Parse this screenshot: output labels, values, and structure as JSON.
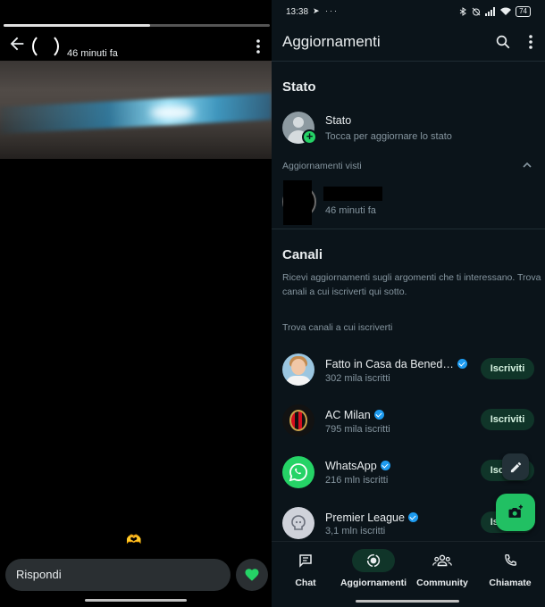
{
  "left": {
    "progress_fraction": 0.55,
    "time_ago": "46 minuti fa",
    "reply_placeholder": "Rispondi",
    "heart_glyph": "🫶",
    "icons": {
      "back": "arrow-left-icon",
      "more": "more-vertical-icon",
      "like": "heart-icon"
    }
  },
  "statusbar": {
    "time": "13:38",
    "left_icons": "➤ ···",
    "battery": "74"
  },
  "header": {
    "title": "Aggiornamenti"
  },
  "status_section": {
    "title": "Stato",
    "my_status": {
      "title": "Stato",
      "subtitle": "Tocca per aggiornare lo stato"
    },
    "viewed_header": "Aggiornamenti visti",
    "viewed_item": {
      "time": "46 minuti fa"
    }
  },
  "channels_section": {
    "title": "Canali",
    "description": "Ricevi aggiornamenti sugli argomenti che ti interessano. Trova canali a cui iscriverti qui sotto.",
    "find_header": "Trova canali a cui iscriverti",
    "subscribe_label": "Iscriviti",
    "channels": [
      {
        "name": "Fatto in Casa da Bened…",
        "followers": "302 mila iscritti",
        "verified": true,
        "avatar": "person-photo"
      },
      {
        "name": "AC Milan",
        "followers": "795 mila iscritti",
        "verified": true,
        "avatar": "ac-milan-crest"
      },
      {
        "name": "WhatsApp",
        "followers": "216 mln iscritti",
        "verified": true,
        "avatar": "whatsapp-logo"
      },
      {
        "name": "Premier League",
        "followers": "3,1 mln iscritti",
        "verified": true,
        "avatar": "premier-league-logo"
      }
    ]
  },
  "nav": {
    "items": [
      {
        "label": "Chat",
        "icon": "chat-icon",
        "active": false
      },
      {
        "label": "Aggiornamenti",
        "icon": "updates-icon",
        "active": true
      },
      {
        "label": "Community",
        "icon": "community-icon",
        "active": false
      },
      {
        "label": "Chiamate",
        "icon": "phone-icon",
        "active": false
      }
    ]
  },
  "colors": {
    "background": "#0b141a",
    "accent_green": "#25d366",
    "fab_green": "#21c063",
    "subscribe_bg": "#103529",
    "muted_text": "#8696a0",
    "verified_blue": "#1d9bf0"
  }
}
